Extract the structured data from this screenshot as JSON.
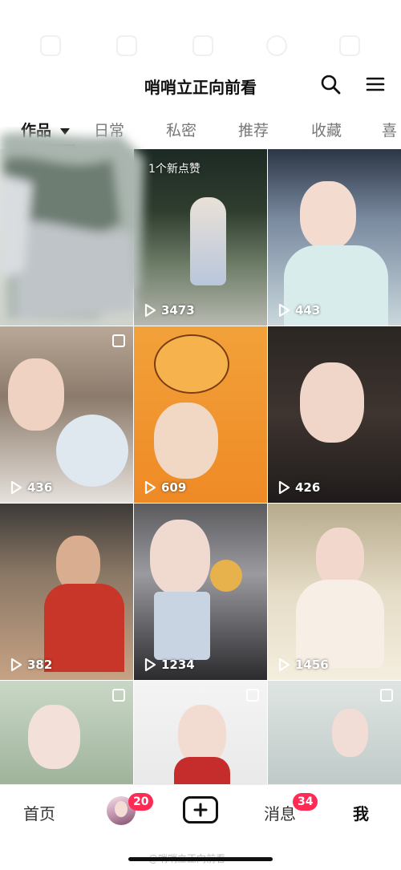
{
  "status_bar_ghost": {
    "text": ""
  },
  "header": {
    "title": "哨哨立正向前看",
    "search_icon": "search-icon",
    "menu_icon": "menu-icon"
  },
  "tabs": [
    {
      "label": "作品",
      "active": true,
      "has_dropdown": true
    },
    {
      "label": "日常",
      "active": false
    },
    {
      "label": "私密",
      "active": false
    },
    {
      "label": "推荐",
      "active": false
    },
    {
      "label": "收藏",
      "active": false
    },
    {
      "label": "喜",
      "active": false
    }
  ],
  "grid": {
    "new_likes_banner": "1个新点赞",
    "items": [
      {
        "views": ""
      },
      {
        "views": "3473"
      },
      {
        "views": "443"
      },
      {
        "views": "436"
      },
      {
        "views": "609"
      },
      {
        "views": "426"
      },
      {
        "views": "382"
      },
      {
        "views": "1234"
      },
      {
        "views": "1456"
      },
      {
        "views": ""
      },
      {
        "views": ""
      },
      {
        "views": ""
      }
    ]
  },
  "bottom_nav": {
    "home": "首页",
    "friends_badge": "20",
    "create_icon": "plus-icon",
    "messages": "消息",
    "messages_badge": "34",
    "me": "我"
  },
  "watermark": "@哨哨立正向前看",
  "colors": {
    "badge": "#fe2c55",
    "text": "#111111",
    "tab_inactive": "#777777"
  }
}
